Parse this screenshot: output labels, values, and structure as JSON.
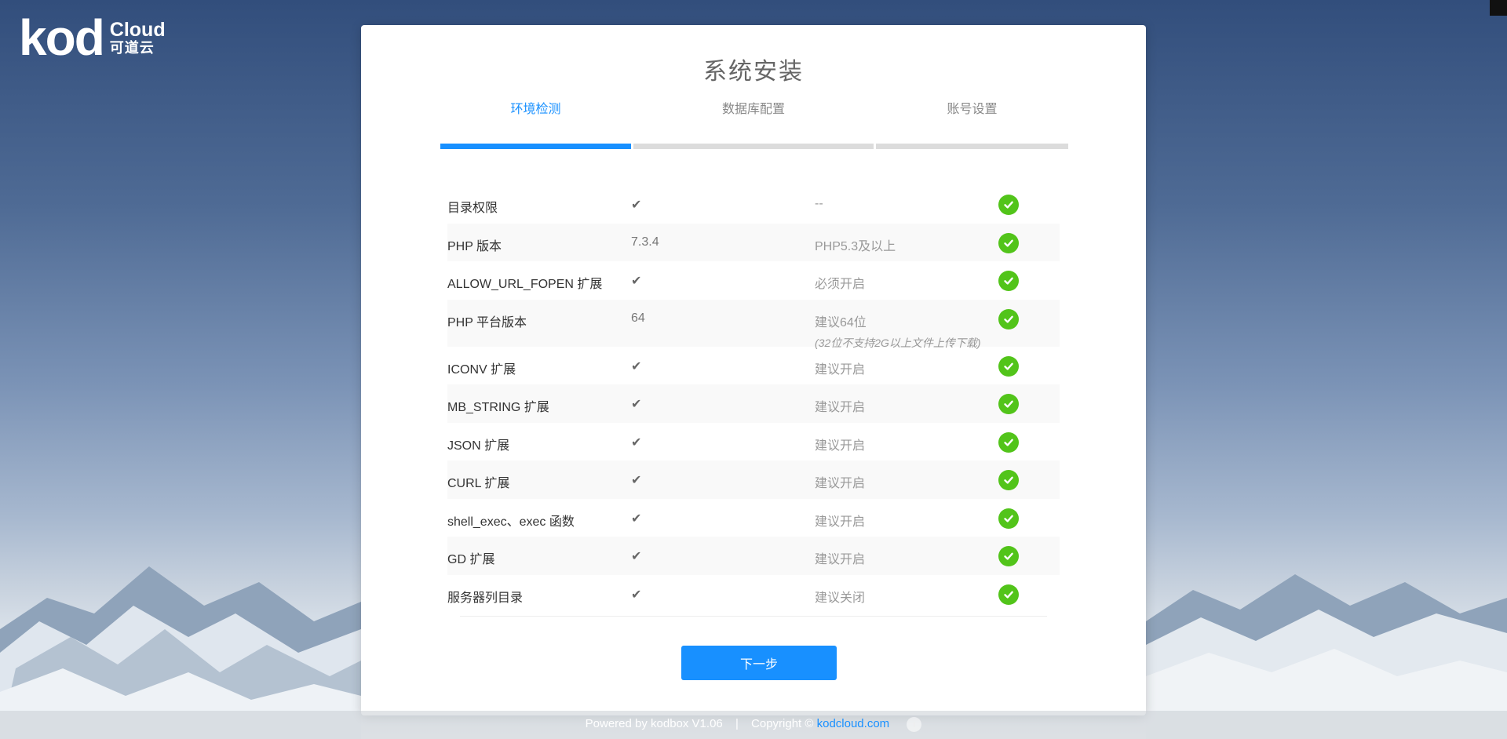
{
  "logo": {
    "mark": "kod",
    "cloud": "Cloud",
    "cn": "可道云"
  },
  "card": {
    "title": "系统安装"
  },
  "steps": [
    {
      "label": "环境检测",
      "active": true
    },
    {
      "label": "数据库配置",
      "active": false
    },
    {
      "label": "账号设置",
      "active": false
    }
  ],
  "rows": [
    {
      "name": "目录权限",
      "value": "✔",
      "requirement": "--",
      "note": ""
    },
    {
      "name": "PHP 版本",
      "value": "7.3.4",
      "requirement": "PHP5.3及以上",
      "note": ""
    },
    {
      "name": "ALLOW_URL_FOPEN 扩展",
      "value": "✔",
      "requirement": "必须开启",
      "note": ""
    },
    {
      "name": "PHP 平台版本",
      "value": "64",
      "requirement": "建议64位",
      "note": "(32位不支持2G以上文件上传下载)"
    },
    {
      "name": "ICONV 扩展",
      "value": "✔",
      "requirement": "建议开启",
      "note": ""
    },
    {
      "name": "MB_STRING 扩展",
      "value": "✔",
      "requirement": "建议开启",
      "note": ""
    },
    {
      "name": "JSON 扩展",
      "value": "✔",
      "requirement": "建议开启",
      "note": ""
    },
    {
      "name": "CURL 扩展",
      "value": "✔",
      "requirement": "建议开启",
      "note": ""
    },
    {
      "name": "shell_exec、exec 函数",
      "value": "✔",
      "requirement": "建议开启",
      "note": ""
    },
    {
      "name": "GD 扩展",
      "value": "✔",
      "requirement": "建议开启",
      "note": ""
    },
    {
      "name": "服务器列目录",
      "value": "✔",
      "requirement": "建议关闭",
      "note": ""
    }
  ],
  "status_icon": "check-circle-icon",
  "next_button": {
    "label": "下一步"
  },
  "footer": {
    "powered": "Powered by kodbox V1.06",
    "separator": "|",
    "copyright": "Copyright ©",
    "link": "kodcloud.com",
    "info": "i"
  },
  "colors": {
    "accent": "#1890ff",
    "success": "#52c41a"
  }
}
